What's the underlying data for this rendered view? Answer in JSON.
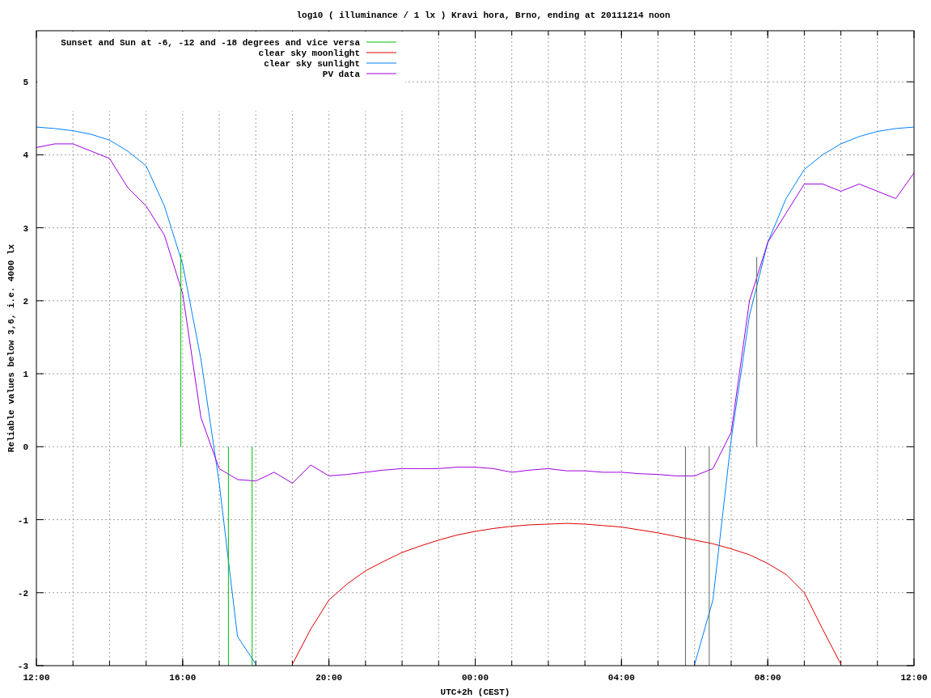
{
  "chart_data": {
    "type": "line",
    "title": "log10 ( illuminance / 1 lx ) Kravi hora, Brno, ending at 20111214 noon",
    "xlabel": "UTC+2h (CEST)",
    "ylabel": "Reliable values below 3,6, i.e. 4000 lx",
    "categories": [
      "12:00",
      null,
      null,
      null,
      null,
      null,
      null,
      null,
      "16:00",
      null,
      null,
      null,
      null,
      null,
      null,
      null,
      "20:00",
      null,
      null,
      null,
      null,
      null,
      null,
      null,
      "00:00",
      null,
      null,
      null,
      null,
      null,
      null,
      null,
      "04:00",
      null,
      null,
      null,
      null,
      null,
      null,
      null,
      "08:00",
      null,
      null,
      null,
      null,
      null,
      null,
      null,
      "12:00"
    ],
    "series": [
      {
        "name": "Sunset and Sun at -6, -12 and -18 degrees and vice versa",
        "color": "#00c000",
        "values": [
          null,
          null,
          null,
          null,
          null,
          null,
          null,
          null,
          null,
          null,
          null,
          null,
          null,
          null,
          null,
          null,
          null,
          null,
          null,
          null,
          null,
          null,
          null,
          null,
          null,
          null,
          null,
          null,
          null,
          null,
          null,
          null,
          null,
          null,
          null,
          null,
          null,
          null,
          null,
          null,
          null,
          null,
          null,
          null,
          null,
          null,
          null,
          null,
          null
        ]
      },
      {
        "name": "clear sky moonlight",
        "color": "#e00000",
        "values": [
          null,
          null,
          null,
          null,
          null,
          null,
          null,
          null,
          null,
          null,
          null,
          null,
          null,
          null,
          -2.98,
          -2.5,
          -2.1,
          -1.88,
          -1.7,
          -1.57,
          -1.45,
          -1.36,
          -1.28,
          -1.21,
          -1.16,
          -1.12,
          -1.09,
          -1.07,
          -1.06,
          -1.05,
          -1.06,
          -1.08,
          -1.1,
          -1.14,
          -1.18,
          -1.23,
          -1.28,
          -1.33,
          -1.4,
          -1.48,
          -1.6,
          -1.75,
          -2.0,
          -2.5,
          -2.98,
          null,
          null,
          null,
          null
        ]
      },
      {
        "name": "clear sky sunlight",
        "color": "#0080ff",
        "values": [
          4.38,
          4.36,
          4.33,
          4.28,
          4.2,
          4.05,
          3.85,
          3.3,
          2.5,
          1.2,
          -0.5,
          -2.6,
          -2.98,
          null,
          null,
          null,
          null,
          null,
          null,
          null,
          null,
          null,
          null,
          null,
          null,
          null,
          null,
          null,
          null,
          null,
          null,
          null,
          null,
          null,
          null,
          null,
          -2.98,
          -2.1,
          0.1,
          1.8,
          2.8,
          3.4,
          3.8,
          4.0,
          4.15,
          4.25,
          4.32,
          4.36,
          4.38
        ]
      },
      {
        "name": "PV data",
        "color": "#a000e0",
        "values": [
          4.1,
          4.15,
          4.15,
          4.05,
          3.95,
          3.55,
          3.3,
          2.9,
          2.1,
          0.4,
          -0.3,
          -0.45,
          -0.47,
          -0.35,
          -0.5,
          -0.25,
          -0.4,
          -0.38,
          -0.35,
          -0.32,
          -0.3,
          -0.3,
          -0.3,
          -0.28,
          -0.28,
          -0.3,
          -0.35,
          -0.32,
          -0.3,
          -0.33,
          -0.33,
          -0.35,
          -0.35,
          -0.37,
          -0.38,
          -0.4,
          -0.4,
          -0.3,
          0.2,
          2.0,
          2.8,
          3.2,
          3.6,
          3.6,
          3.5,
          3.6,
          3.5,
          3.4,
          3.75
        ]
      }
    ],
    "ylim": [
      -3,
      5.7
    ],
    "yticks": [
      -3,
      -2,
      -1,
      0,
      1,
      2,
      3,
      4,
      5
    ],
    "grid": true,
    "legend": true
  }
}
